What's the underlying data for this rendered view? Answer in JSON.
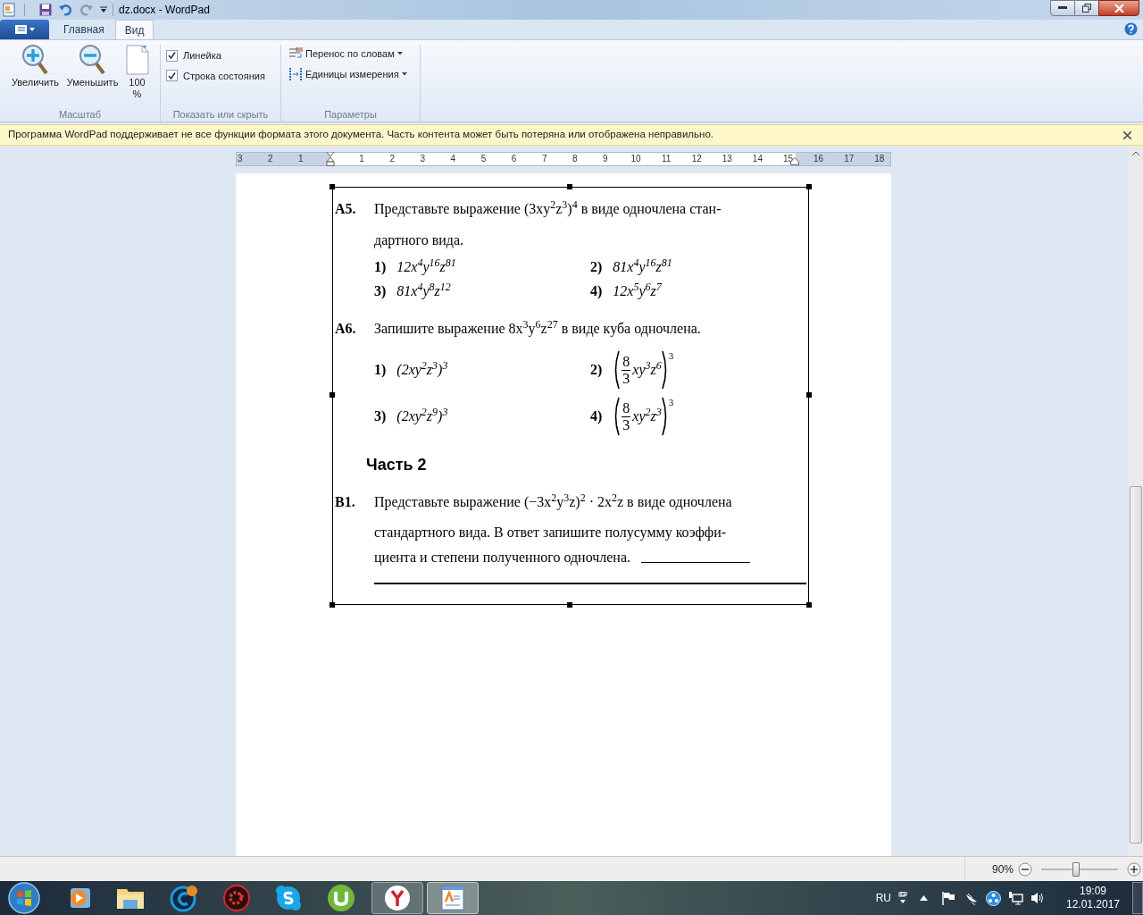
{
  "window": {
    "title": "dz.docx - WordPad"
  },
  "ribbon": {
    "tabs": [
      {
        "label": "Главная",
        "selected": false
      },
      {
        "label": "Вид",
        "selected": true
      }
    ],
    "zoom_group": {
      "label": "Масштаб",
      "zoom_in": "Увеличить",
      "zoom_out": "Уменьшить",
      "actual_size": "100 %"
    },
    "show_group": {
      "label": "Показать или скрыть",
      "checkboxes": [
        {
          "label": "Линейка",
          "checked": true
        },
        {
          "label": "Строка состояния",
          "checked": true
        }
      ]
    },
    "options_group": {
      "label": "Параметры",
      "dropdowns": [
        "Перенос по словам",
        "Единицы измерения"
      ]
    }
  },
  "info_bar": {
    "message": "Программа WordPad поддерживает не все функции формата этого документа. Часть контента может быть потеряна или отображена неправильно."
  },
  "ruler": {
    "scale": "3 2 1 1 2 3 4 5 6 7 8 9 10 11 12 13 14 15 16 17 18"
  },
  "document": {
    "questions": [
      {
        "label": "A5.",
        "lines": [
          "Представьте выражение (3xy$^{2}$z$^{3}$)$^{4}$ в виде одночлена стан-",
          "дартного вида."
        ],
        "options": [
          {
            "kind": "text",
            "number": "1)",
            "expr": "12x$^{4}$y$^{16}$z$^{81}$"
          },
          {
            "kind": "text",
            "number": "2)",
            "expr": "81x$^{4}$y$^{16}$z$^{81}$"
          },
          {
            "kind": "text",
            "number": "3)",
            "expr": "81x$^{4}$y$^{8}$z$^{12}$"
          },
          {
            "kind": "text",
            "number": "4)",
            "expr": "12x$^{5}$y$^{6}$z$^{7}$"
          }
        ]
      },
      {
        "label": "A6.",
        "lines": [
          "Запишите выражение 8x$^{3}$y$^{6}$z$^{27}$ в виде куба одночлена."
        ],
        "options": [
          {
            "kind": "text",
            "number": "1)",
            "expr": "(2xy$^{2}$z$^{3}$)$^{3}$"
          },
          {
            "kind": "fraction",
            "number": "2)",
            "numerator": "8",
            "denominator": "3",
            "expr": "xy$^{3}$z$^{6}$",
            "power": "3"
          },
          {
            "kind": "text",
            "number": "3)",
            "expr": "(2xy$^{2}$z$^{9}$)$^{3}$"
          },
          {
            "kind": "fraction",
            "number": "4)",
            "numerator": "8",
            "denominator": "3",
            "expr": "xy$^{2}$z$^{3}$",
            "power": "3"
          }
        ]
      }
    ],
    "section": "Часть 2",
    "answer_question": {
      "label": "B1.",
      "lines": [
        "Представьте выражение (−3x$^{2}$y$^{3}$z)$^{2}$ · 2x$^{2}$z в виде одночлена",
        "стандартного вида. В ответ запишите полусумму коэффи-",
        "циента и степени полученного одночлена."
      ]
    }
  },
  "status_bar": {
    "zoom": "90%",
    "level": 0.45
  },
  "taskbar": {
    "language": "RU",
    "time": "19:09",
    "date": "12.01.2017"
  }
}
